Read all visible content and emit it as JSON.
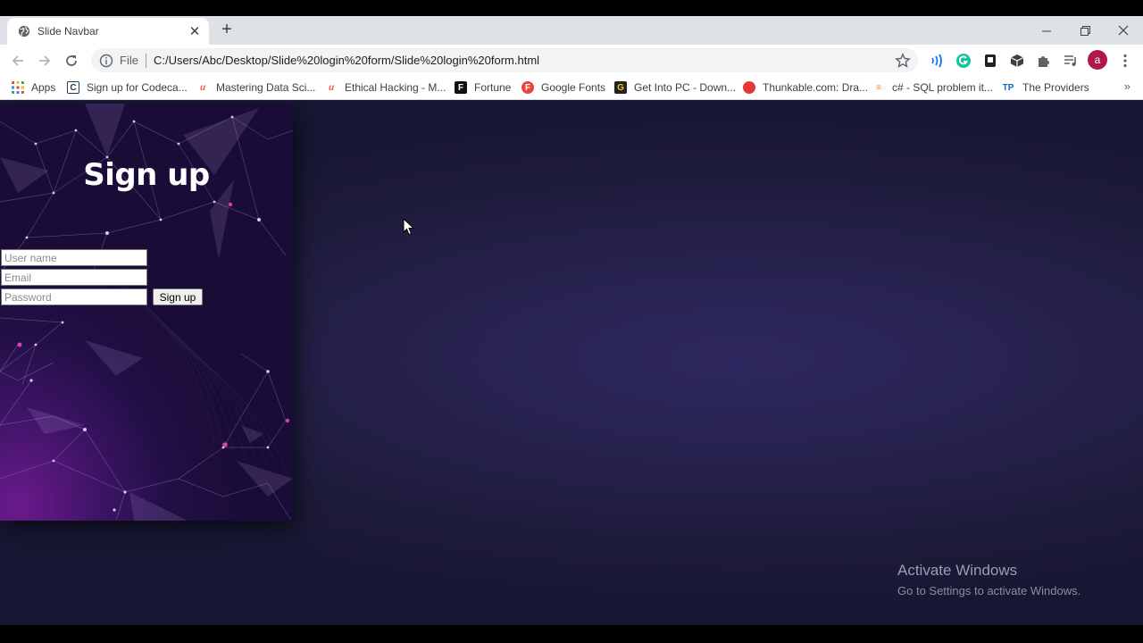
{
  "browser": {
    "tab": {
      "title": "Slide Navbar",
      "favicon": "globe-icon"
    },
    "window_controls": {
      "minimize": "minimize-icon",
      "restore": "restore-icon",
      "close": "close-icon"
    },
    "omnibox": {
      "scheme": "File",
      "url": "C:/Users/Abc/Desktop/Slide%20login%20form/Slide%20login%20form.html"
    },
    "profile_initial": "a",
    "bookmarks": [
      {
        "label": "Apps",
        "icon": "apps-grid-icon"
      },
      {
        "label": "Sign up for Codeca...",
        "icon": "codecademy-icon"
      },
      {
        "label": "Mastering Data Sci...",
        "icon": "udemy-icon"
      },
      {
        "label": "Ethical Hacking - M...",
        "icon": "udemy-icon"
      },
      {
        "label": "Fortune",
        "icon": "fortune-icon"
      },
      {
        "label": "Google Fonts",
        "icon": "google-fonts-icon"
      },
      {
        "label": "Get Into PC - Down...",
        "icon": "getintopc-icon"
      },
      {
        "label": "Thunkable.com: Dra...",
        "icon": "thunkable-icon"
      },
      {
        "label": "c# - SQL problem it...",
        "icon": "stackoverflow-icon"
      },
      {
        "label": "The Providers",
        "icon": "tp-icon"
      }
    ],
    "bookmarks_more": "»"
  },
  "page": {
    "signup": {
      "title": "Sign up",
      "username_placeholder": "User name",
      "email_placeholder": "Email",
      "password_placeholder": "Password",
      "submit_label": "Sign up"
    },
    "watermark": {
      "line1": "Activate Windows",
      "line2": "Go to Settings to activate Windows."
    }
  },
  "colors": {
    "page_background": "#221f45",
    "panel_purple": "#3e1466",
    "panel_magenta": "#6b1a8c"
  }
}
